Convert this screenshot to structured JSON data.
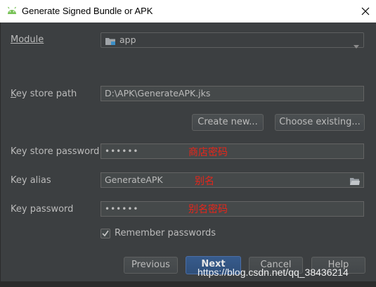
{
  "window": {
    "title": "Generate Signed Bundle or APK",
    "app_icon": "android-icon",
    "close_icon": "close-icon"
  },
  "module": {
    "label": "Module",
    "value": "app"
  },
  "keystore": {
    "path_label": "Key store path",
    "path_value": "D:\\APK\\GenerateAPK.jks",
    "create_new": "Create new...",
    "choose_existing": "Choose existing...",
    "password_label": "Key store password",
    "password_value": "••••••",
    "password_note": "商店密码"
  },
  "key": {
    "alias_label": "Key alias",
    "alias_value": "GenerateAPK",
    "alias_note": "别名",
    "password_label": "Key password",
    "password_value": "••••••",
    "password_note": "别名密码"
  },
  "remember": {
    "label": "Remember passwords",
    "checked": true
  },
  "buttons": {
    "previous": "Previous",
    "next": "Next",
    "cancel": "Cancel",
    "help": "Help"
  },
  "watermark": "https://blog.csdn.net/qq_38436214",
  "colors": {
    "background": "#3c3f41",
    "field": "#45494a",
    "note_red": "#e8251a",
    "primary_button": "#375b8c"
  }
}
